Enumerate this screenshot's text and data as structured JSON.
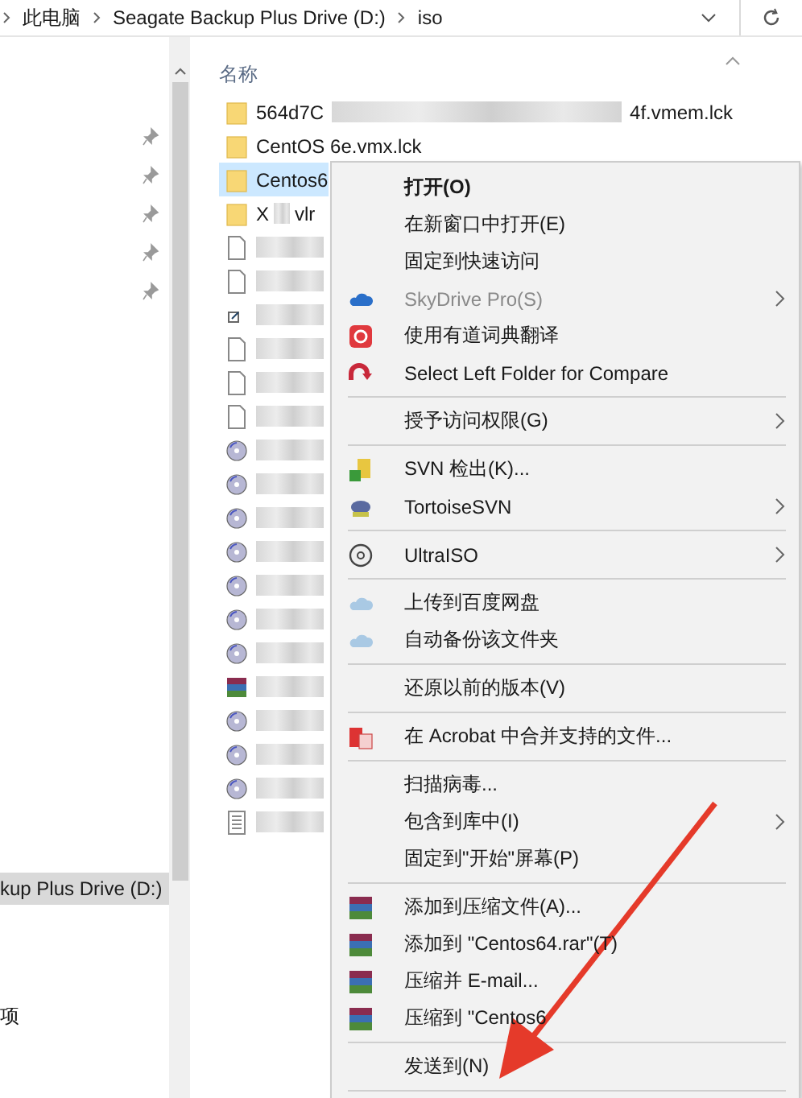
{
  "address_bar": {
    "segments": [
      "此电脑",
      "Seagate Backup Plus Drive (D:)",
      "iso"
    ]
  },
  "nav_pane": {
    "items": [
      {
        "label": "kup Plus Drive (D:)",
        "selected": true
      },
      {
        "label": "项",
        "selected": false
      }
    ]
  },
  "file_list": {
    "column_header": "名称",
    "files": [
      {
        "kind": "folder",
        "name_start": "564d7C",
        "redacted": true,
        "name_end": "4f.vmem.lck",
        "selected": false
      },
      {
        "kind": "folder",
        "name_start": "CentOS 6e.vmx.lck",
        "redacted": false,
        "selected": false
      },
      {
        "kind": "folder",
        "name_start": "Centos6",
        "redacted": false,
        "selected": true
      },
      {
        "kind": "folder",
        "name_start": "X",
        "redacted": true,
        "name_end": "vlr",
        "selected": false
      },
      {
        "kind": "file",
        "redacted": true,
        "selected": false
      },
      {
        "kind": "file",
        "redacted": true,
        "selected": false
      },
      {
        "kind": "link",
        "redacted": true,
        "selected": false
      },
      {
        "kind": "file",
        "redacted": true,
        "selected": false
      },
      {
        "kind": "file",
        "redacted": true,
        "selected": false
      },
      {
        "kind": "file",
        "redacted": true,
        "selected": false
      },
      {
        "kind": "disc",
        "redacted": true,
        "selected": false
      },
      {
        "kind": "disc",
        "redacted": true,
        "selected": false
      },
      {
        "kind": "disc",
        "redacted": true,
        "selected": false
      },
      {
        "kind": "disc",
        "redacted": true,
        "selected": false
      },
      {
        "kind": "disc",
        "redacted": true,
        "selected": false
      },
      {
        "kind": "disc",
        "redacted": true,
        "selected": false
      },
      {
        "kind": "disc",
        "redacted": true,
        "selected": false
      },
      {
        "kind": "archive",
        "redacted": true,
        "selected": false
      },
      {
        "kind": "disc",
        "redacted": true,
        "selected": false
      },
      {
        "kind": "disc",
        "redacted": true,
        "selected": false
      },
      {
        "kind": "disc",
        "redacted": true,
        "selected": false
      },
      {
        "kind": "text",
        "redacted": true,
        "selected": false
      }
    ]
  },
  "context_menu": {
    "entries": [
      {
        "kind": "item",
        "label": "打开(O)",
        "bold": true,
        "disabled": false,
        "submenu": false
      },
      {
        "kind": "item",
        "label": "在新窗口中打开(E)",
        "bold": false,
        "disabled": false,
        "submenu": false
      },
      {
        "kind": "item",
        "label": "固定到快速访问",
        "bold": false,
        "disabled": false,
        "submenu": false
      },
      {
        "kind": "item",
        "label": "SkyDrive Pro(S)",
        "bold": false,
        "disabled": true,
        "submenu": true
      },
      {
        "kind": "item",
        "label": "使用有道词典翻译",
        "bold": false,
        "disabled": false,
        "submenu": false
      },
      {
        "kind": "item",
        "label": "Select Left Folder for Compare",
        "bold": false,
        "disabled": false,
        "submenu": false
      },
      {
        "kind": "separator"
      },
      {
        "kind": "item",
        "label": "授予访问权限(G)",
        "bold": false,
        "disabled": false,
        "submenu": true
      },
      {
        "kind": "separator"
      },
      {
        "kind": "item",
        "label": "SVN 检出(K)...",
        "bold": false,
        "disabled": false,
        "submenu": false
      },
      {
        "kind": "item",
        "label": "TortoiseSVN",
        "bold": false,
        "disabled": false,
        "submenu": true
      },
      {
        "kind": "separator"
      },
      {
        "kind": "item",
        "label": "UltraISO",
        "bold": false,
        "disabled": false,
        "submenu": true
      },
      {
        "kind": "separator"
      },
      {
        "kind": "item",
        "label": "上传到百度网盘",
        "bold": false,
        "disabled": false,
        "submenu": false
      },
      {
        "kind": "item",
        "label": "自动备份该文件夹",
        "bold": false,
        "disabled": false,
        "submenu": false
      },
      {
        "kind": "separator"
      },
      {
        "kind": "item",
        "label": "还原以前的版本(V)",
        "bold": false,
        "disabled": false,
        "submenu": false
      },
      {
        "kind": "separator"
      },
      {
        "kind": "item",
        "label": "在 Acrobat 中合并支持的文件...",
        "bold": false,
        "disabled": false,
        "submenu": false
      },
      {
        "kind": "separator"
      },
      {
        "kind": "item",
        "label": "扫描病毒...",
        "bold": false,
        "disabled": false,
        "submenu": false
      },
      {
        "kind": "item",
        "label": "包含到库中(I)",
        "bold": false,
        "disabled": false,
        "submenu": true
      },
      {
        "kind": "item",
        "label": "固定到\"开始\"屏幕(P)",
        "bold": false,
        "disabled": false,
        "submenu": false
      },
      {
        "kind": "separator"
      },
      {
        "kind": "item",
        "label": "添加到压缩文件(A)...",
        "bold": false,
        "disabled": false,
        "submenu": false
      },
      {
        "kind": "item",
        "label": "添加到 \"Centos64.rar\"(T)",
        "bold": false,
        "disabled": false,
        "submenu": false
      },
      {
        "kind": "item",
        "label": "压缩并 E-mail...",
        "bold": false,
        "disabled": false,
        "submenu": false
      },
      {
        "kind": "item",
        "label": "压缩到 \"Centos6",
        "bold": false,
        "disabled": false,
        "submenu": false
      },
      {
        "kind": "separator"
      },
      {
        "kind": "item",
        "label": "发送到(N)",
        "bold": false,
        "disabled": false,
        "submenu": false
      },
      {
        "kind": "separator"
      }
    ]
  },
  "annotation": {
    "kind": "arrow"
  }
}
